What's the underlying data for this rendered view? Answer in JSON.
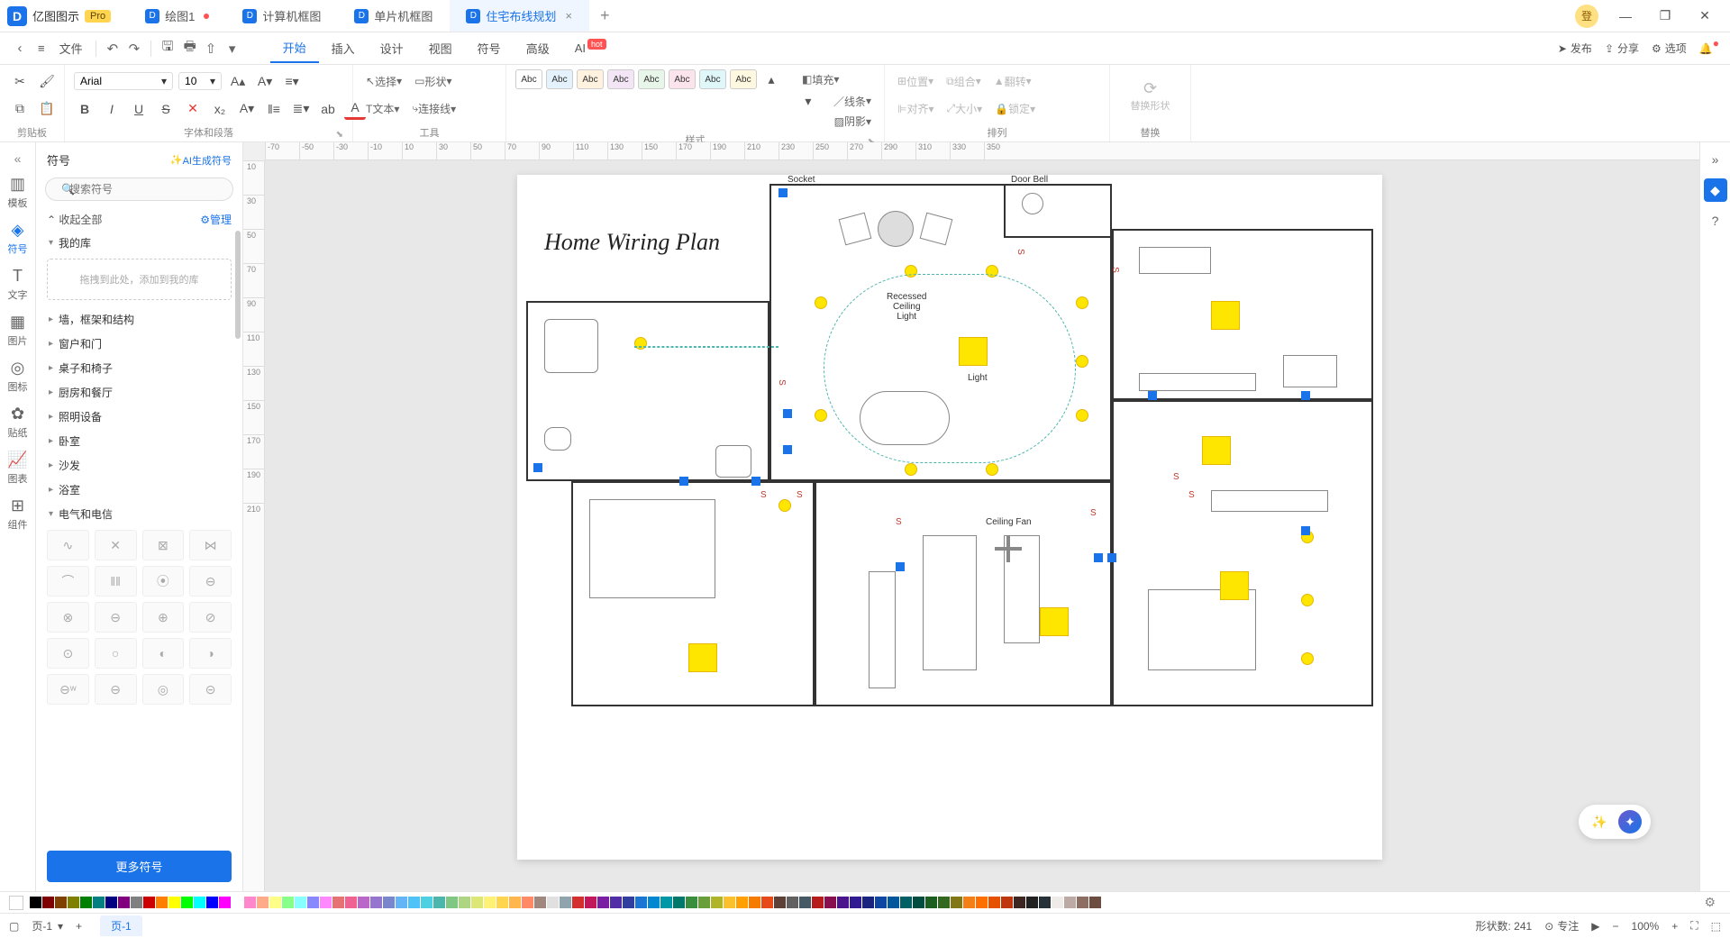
{
  "app": {
    "name": "亿图图示",
    "badge": "Pro",
    "avatar_label": "登"
  },
  "tabs": [
    {
      "label": "绘图1",
      "dirty": true
    },
    {
      "label": "计算机框图",
      "dirty": false
    },
    {
      "label": "单片机框图",
      "dirty": false
    },
    {
      "label": "住宅布线规划",
      "dirty": false,
      "active": true
    }
  ],
  "window": {
    "minimize": "—",
    "maximize": "❐",
    "close": "✕"
  },
  "menubar": {
    "hamburger": "≡",
    "file": "文件",
    "undo": "↶",
    "redo": "↷",
    "save": "💾",
    "print": "🖨",
    "export": "↗",
    "more": "…",
    "tabs": [
      "开始",
      "插入",
      "设计",
      "视图",
      "符号",
      "高级"
    ],
    "ai": "AI",
    "ai_badge": "hot",
    "right": {
      "publish": "发布",
      "share": "分享",
      "options": "选项",
      "notif": "•"
    }
  },
  "ribbon": {
    "clipboard": {
      "label": "剪贴板",
      "cut": "✂",
      "copy": "⧉",
      "paste": "📋",
      "format_painter": "🖌"
    },
    "font": {
      "label": "字体和段落",
      "family": "Arial",
      "size": "10",
      "bold": "B",
      "italic": "I",
      "underline": "U",
      "strike": "S",
      "clear_fmt": "✕",
      "sub": "x₂",
      "sup": "A",
      "line_h": "≡",
      "list": "≣",
      "case": "ab",
      "color": "A"
    },
    "tools": {
      "label": "工具",
      "select": "选择",
      "shape": "形状",
      "text": "文本",
      "connector": "连接线"
    },
    "styles": {
      "label": "样式",
      "abc": "Abc",
      "fill": "填充",
      "line": "线条",
      "shadow": "阴影"
    },
    "arrange": {
      "label": "排列",
      "position": "位置",
      "group": "组合",
      "flip": "翻转",
      "align": "对齐",
      "size": "大小",
      "lock": "锁定"
    },
    "replace": {
      "label": "替换",
      "replace_shape": "替换形状"
    }
  },
  "left_rail": {
    "collapse": "«",
    "items": [
      {
        "icon": "▥",
        "label": "模板"
      },
      {
        "icon": "◈",
        "label": "符号",
        "active": true
      },
      {
        "icon": "T",
        "label": "文字"
      },
      {
        "icon": "▦",
        "label": "图片"
      },
      {
        "icon": "◎",
        "label": "图标"
      },
      {
        "icon": "✿",
        "label": "贴纸"
      },
      {
        "icon": "📈",
        "label": "图表"
      },
      {
        "icon": "⊞",
        "label": "组件"
      }
    ]
  },
  "symbols": {
    "title": "符号",
    "ai_gen": "AI生成符号",
    "search_placeholder": "搜索符号",
    "collapse_all": "收起全部",
    "manage": "管理",
    "my_lib": "我的库",
    "drop_hint": "拖拽到此处，添加到我的库",
    "categories": [
      "墙，框架和结构",
      "窗户和门",
      "桌子和椅子",
      "厨房和餐厅",
      "照明设备",
      "卧室",
      "沙发",
      "浴室",
      "电气和电信"
    ],
    "more": "更多符号"
  },
  "ruler_h": [
    "-70",
    "-50",
    "-30",
    "-10",
    "10",
    "30",
    "50",
    "70",
    "90",
    "110",
    "130",
    "150",
    "170",
    "190",
    "210",
    "230",
    "250",
    "270",
    "290",
    "310",
    "330",
    "350"
  ],
  "ruler_v": [
    "10",
    "30",
    "50",
    "70",
    "90",
    "110",
    "130",
    "150",
    "170",
    "190",
    "210"
  ],
  "plan": {
    "title": "Home Wiring Plan",
    "labels": {
      "socket": "Socket",
      "door_bell": "Door Bell",
      "recessed": "Recessed\nCeiling\nLight",
      "light": "Light",
      "ceiling_fan": "Ceiling Fan"
    }
  },
  "colorbar_hint": "none",
  "statusbar": {
    "page_label": "页-1",
    "page_tab": "页-1",
    "shapes_label": "形状数:",
    "shapes_count": "241",
    "focus": "专注",
    "zoom": "100%"
  },
  "float": {
    "wand": "✨",
    "magic": "✦"
  }
}
